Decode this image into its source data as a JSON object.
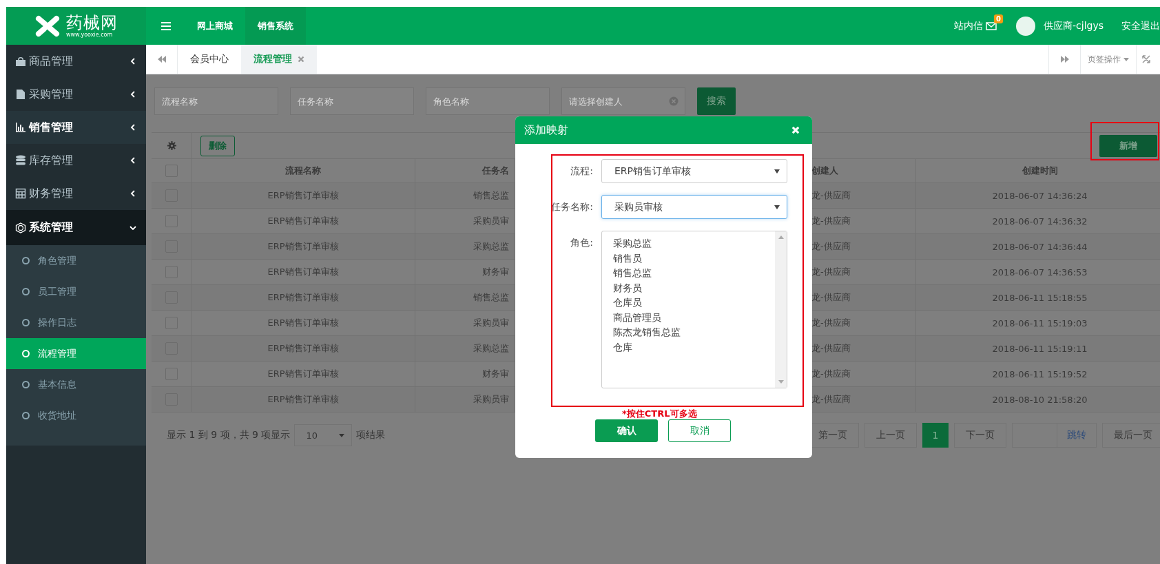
{
  "logo": {
    "name": "药械网",
    "url": "www.yooxie.com"
  },
  "top_nav": [
    {
      "label": "网上商城",
      "selected": false
    },
    {
      "label": "销售系统",
      "selected": true
    }
  ],
  "user_bar": {
    "messages": "站内信",
    "message_count": "0",
    "user": "供应商-cjlgys",
    "logout": "安全退出"
  },
  "sidebar": {
    "items": [
      {
        "label": "商品管理",
        "selected": false,
        "expanded": false
      },
      {
        "label": "采购管理",
        "selected": false,
        "expanded": false
      },
      {
        "label": "销售管理",
        "selected": true,
        "expanded": false
      },
      {
        "label": "库存管理",
        "selected": false,
        "expanded": false
      },
      {
        "label": "财务管理",
        "selected": false,
        "expanded": false
      },
      {
        "label": "系统管理",
        "selected": false,
        "expanded": true,
        "children": [
          {
            "label": "角色管理",
            "selected": false
          },
          {
            "label": "员工管理",
            "selected": false
          },
          {
            "label": "操作日志",
            "selected": false
          },
          {
            "label": "流程管理",
            "selected": true
          },
          {
            "label": "基本信息",
            "selected": false
          },
          {
            "label": "收货地址",
            "selected": false
          }
        ]
      }
    ]
  },
  "page_tabs": {
    "tabs": [
      {
        "label": "会员中心",
        "selected": false,
        "closable": false
      },
      {
        "label": "流程管理",
        "selected": true,
        "closable": true
      }
    ],
    "actions": "页签操作"
  },
  "search": {
    "fields": [
      {
        "placeholder": "流程名称",
        "clearable": false
      },
      {
        "placeholder": "任务名称",
        "clearable": false
      },
      {
        "placeholder": "角色名称",
        "clearable": false
      },
      {
        "placeholder": "请选择创建人",
        "clearable": true
      }
    ],
    "button": "搜索"
  },
  "toolbar": {
    "delete": "删除",
    "add": "新增"
  },
  "table": {
    "header_checked": false,
    "columns": {
      "process": "流程名称",
      "task": "任务名",
      "creator": "创建人",
      "time": "创建时间"
    },
    "rows": [
      {
        "checked": false,
        "process": "ERP销售订单审核",
        "task": "销售总监",
        "creator": "龙-供应商",
        "time": "2018-06-07 14:36:24"
      },
      {
        "checked": false,
        "process": "ERP销售订单审核",
        "task": "采购员审",
        "creator": "龙-供应商",
        "time": "2018-06-07 14:36:32"
      },
      {
        "checked": false,
        "process": "ERP销售订单审核",
        "task": "采购总监",
        "creator": "龙-供应商",
        "time": "2018-06-07 14:36:44"
      },
      {
        "checked": false,
        "process": "ERP销售订单审核",
        "task": "财务审",
        "creator": "龙-供应商",
        "time": "2018-06-07 14:36:53"
      },
      {
        "checked": false,
        "process": "ERP销售订单审核",
        "task": "销售总监",
        "creator": "龙-供应商",
        "time": "2018-06-11 15:18:55"
      },
      {
        "checked": false,
        "process": "ERP销售订单审核",
        "task": "采购员审",
        "creator": "龙-供应商",
        "time": "2018-06-11 15:19:03"
      },
      {
        "checked": false,
        "process": "ERP销售订单审核",
        "task": "采购总监",
        "creator": "龙-供应商",
        "time": "2018-06-11 15:19:11"
      },
      {
        "checked": false,
        "process": "ERP销售订单审核",
        "task": "财务审",
        "creator": "龙-供应商",
        "time": "2018-06-11 15:19:52"
      },
      {
        "checked": false,
        "process": "ERP销售订单审核",
        "task": "采购员审",
        "creator": "龙-供应商",
        "time": "2018-08-10 21:58:20"
      }
    ]
  },
  "pagination": {
    "summary": "显示 1 到 9 项，共 9 项显示",
    "page_size": "10",
    "suffix": "项结果",
    "first": "第一页",
    "prev": "上一页",
    "pages": [
      {
        "label": "1",
        "selected": true
      }
    ],
    "next": "下一页",
    "jump": "跳转",
    "last": "最后一页"
  },
  "modal": {
    "title": "添加映射",
    "fields": [
      {
        "kind": "select",
        "label": "流程:",
        "value": "ERP销售订单审核",
        "focused": false
      },
      {
        "kind": "select",
        "label": "任务名称:",
        "value": "采购员审核",
        "focused": true
      },
      {
        "kind": "listbox",
        "label": "角色:",
        "options": [
          {
            "label": "采购总监",
            "selected": false
          },
          {
            "label": "销售员",
            "selected": false
          },
          {
            "label": "销售总监",
            "selected": false
          },
          {
            "label": "财务员",
            "selected": false
          },
          {
            "label": "仓库员",
            "selected": false
          },
          {
            "label": "商品管理员",
            "selected": false
          },
          {
            "label": "陈杰龙销售总监",
            "selected": false
          },
          {
            "label": "仓库",
            "selected": false
          }
        ]
      }
    ],
    "hint": "*按住CTRL可多选",
    "confirm": "确认",
    "cancel": "取消"
  }
}
